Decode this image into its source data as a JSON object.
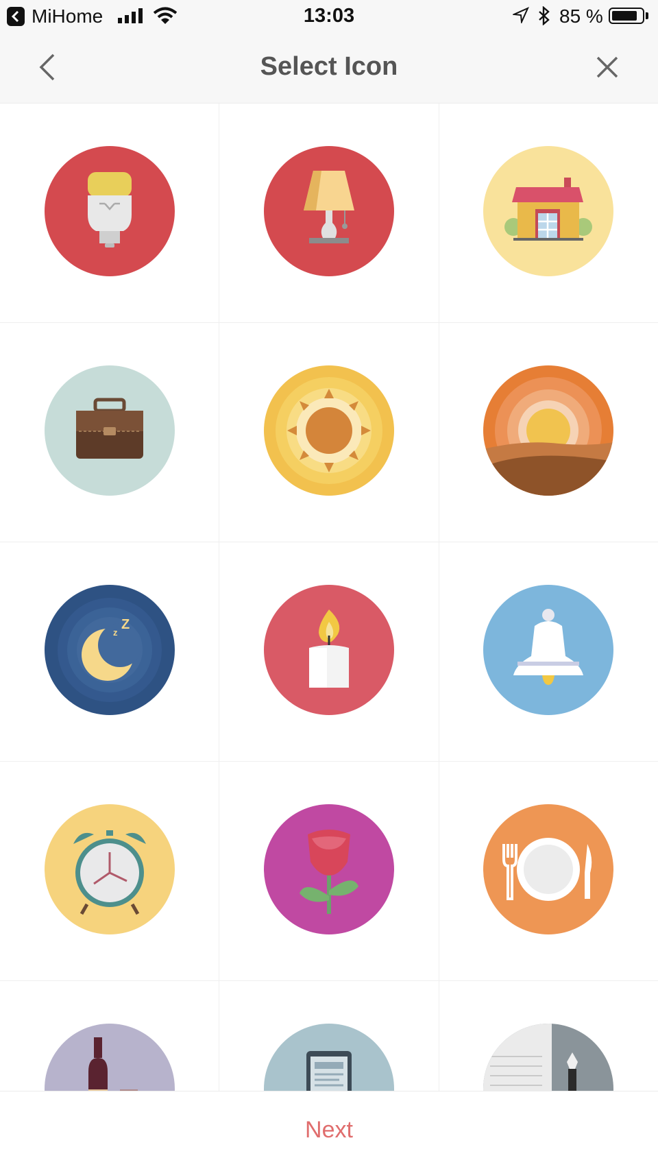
{
  "status_bar": {
    "back_app": "MiHome",
    "time": "13:03",
    "battery": "85 %",
    "battery_level": 0.85
  },
  "navbar": {
    "title": "Select Icon",
    "back_icon": "chevron-left-icon",
    "close_icon": "close-icon"
  },
  "icons": [
    {
      "name": "light-bulb-icon",
      "background": "#d44a4f"
    },
    {
      "name": "table-lamp-icon",
      "background": "#d44a4f"
    },
    {
      "name": "house-icon",
      "background": "#f9e29b"
    },
    {
      "name": "briefcase-icon",
      "background": "#c6dcd8"
    },
    {
      "name": "sun-icon",
      "background": "#f2c14e"
    },
    {
      "name": "sunset-icon",
      "background": "#e67e35"
    },
    {
      "name": "moon-sleep-icon",
      "background": "#2e5283"
    },
    {
      "name": "candle-icon",
      "background": "#d95a66"
    },
    {
      "name": "bell-icon",
      "background": "#7db6dc"
    },
    {
      "name": "alarm-clock-icon",
      "background": "#f6d37d"
    },
    {
      "name": "rose-icon",
      "background": "#c049a2"
    },
    {
      "name": "dinner-plate-icon",
      "background": "#ee9654"
    },
    {
      "name": "wine-icon",
      "background": "#b7b3cc"
    },
    {
      "name": "e-reader-icon",
      "background": "#a9c3cc"
    },
    {
      "name": "notebook-pen-icon",
      "background": "#8a949a"
    }
  ],
  "footer": {
    "next_label": "Next",
    "accent": "#e06d6d"
  }
}
